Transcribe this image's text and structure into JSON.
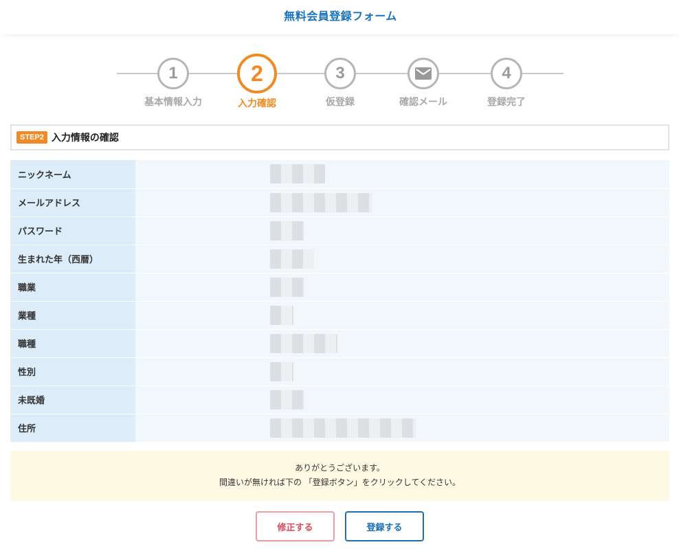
{
  "header": {
    "title": "無料会員登録フォーム"
  },
  "steps": [
    {
      "number": "1",
      "label": "基本情報入力",
      "state": "done"
    },
    {
      "number": "2",
      "label": "入力確認",
      "state": "active"
    },
    {
      "number": "3",
      "label": "仮登録",
      "state": "pending"
    },
    {
      "number": "",
      "icon": "mail-icon",
      "label": "確認メール",
      "state": "pending"
    },
    {
      "number": "4",
      "label": "登録完了",
      "state": "pending"
    }
  ],
  "section": {
    "badge": "STEP2",
    "title": "入力情報の確認"
  },
  "fields": [
    {
      "label": "ニックネーム",
      "masked": true
    },
    {
      "label": "メールアドレス",
      "masked": true
    },
    {
      "label": "パスワード",
      "masked": true
    },
    {
      "label": "生まれた年（西暦）",
      "masked": true
    },
    {
      "label": "職業",
      "masked": true
    },
    {
      "label": "業種",
      "masked": true
    },
    {
      "label": "職種",
      "masked": true
    },
    {
      "label": "性別",
      "masked": true
    },
    {
      "label": "未既婚",
      "masked": true
    },
    {
      "label": "住所",
      "masked": true
    }
  ],
  "notice": {
    "line1": "ありがとうございます。",
    "line2": "間違いが無ければ下の 「登録ボタン」をクリックしてください。"
  },
  "buttons": {
    "fix_label": "修正する",
    "register_label": "登録する"
  },
  "colors": {
    "accent": "#f08a24",
    "brand": "#1a73b8",
    "label_bg": "#dcecf8",
    "value_bg": "#f2f7fc",
    "notice_bg": "#fdf9e3"
  }
}
